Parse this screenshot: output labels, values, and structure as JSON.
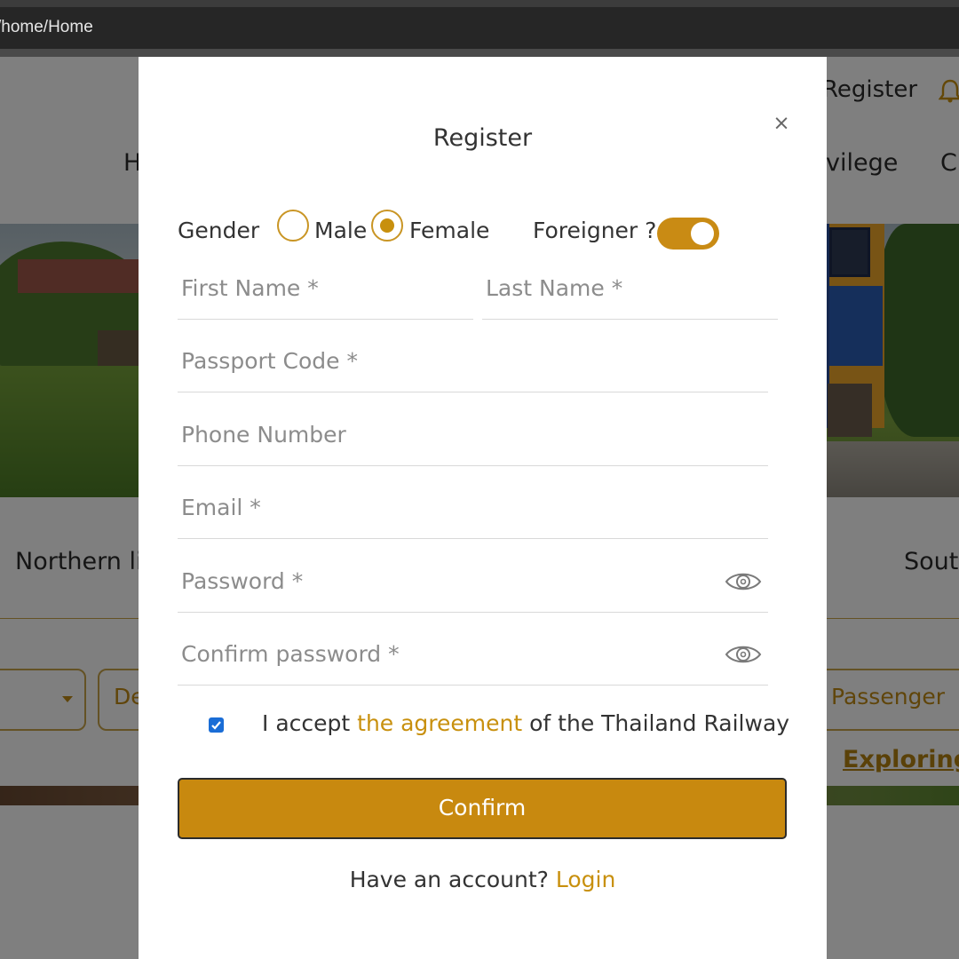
{
  "browser": {
    "address": "/home/Home"
  },
  "background": {
    "header_register": "Register",
    "nav_home_partial": "H",
    "nav_privilege_partial": "vilege",
    "nav_c_partial": "C",
    "northern_partial": "Northern li",
    "south_partial": "Sout",
    "select_de_partial": "De",
    "passenger": "Passenger",
    "exploring_partial": "Exploring T"
  },
  "modal": {
    "title": "Register",
    "close_symbol": "×",
    "gender_label": "Gender",
    "gender_options": [
      "Male",
      "Female"
    ],
    "gender_selected": "Female",
    "foreigner_label": "Foreigner ?",
    "foreigner_toggle_on": true,
    "placeholders": {
      "first_name": "First Name *",
      "last_name": "Last Name *",
      "passport": "Passport Code *",
      "phone": "Phone Number",
      "email": "Email *",
      "password": "Password *",
      "confirm_password": "Confirm password *"
    },
    "agreement": {
      "checked": true,
      "prefix": "I accept ",
      "link": "the agreement",
      "suffix": " of the Thailand Railway"
    },
    "confirm_label": "Confirm",
    "account_prompt": "Have an account? ",
    "login_link": "Login"
  },
  "colors": {
    "accent": "#c8890f",
    "checkbox": "#1a6dd6",
    "overlay": "rgba(0,0,0,0.5)"
  }
}
